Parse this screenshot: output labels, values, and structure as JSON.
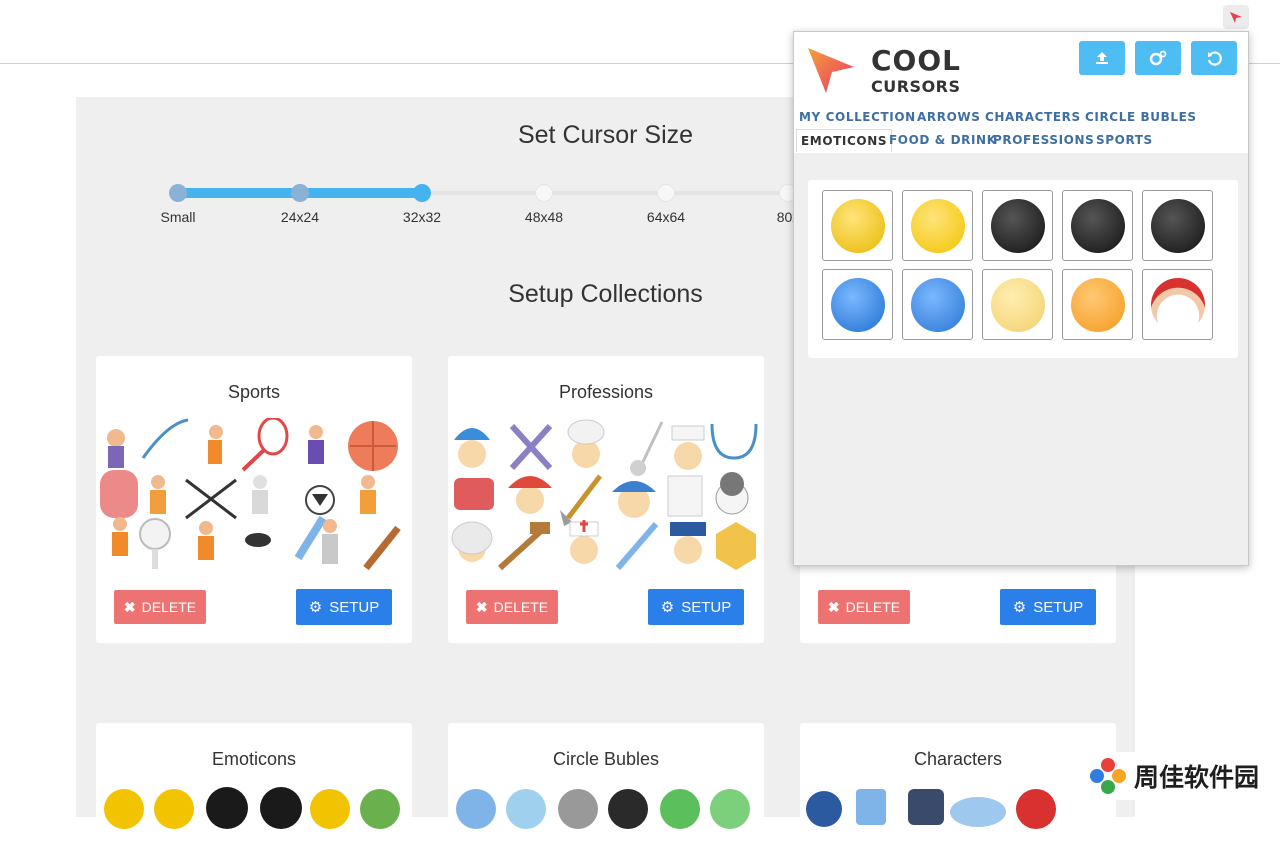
{
  "toolbar": {
    "extension_icon": "cool-cursors-arrow-icon"
  },
  "panel": {
    "size_title": "Set Cursor Size",
    "sizes": [
      "Small",
      "24x24",
      "32x32",
      "48x48",
      "64x64",
      "80x"
    ],
    "selected_size_index": 2,
    "collections_title": "Setup Collections"
  },
  "cards": [
    {
      "title": "Sports",
      "delete_label": "DELETE",
      "setup_label": "SETUP"
    },
    {
      "title": "Professions",
      "delete_label": "DELETE",
      "setup_label": "SETUP"
    },
    {
      "title": "",
      "delete_label": "DELETE",
      "setup_label": "SETUP"
    }
  ],
  "bottom_cards": [
    {
      "title": "Emoticons"
    },
    {
      "title": "Circle Bubles"
    },
    {
      "title": "Characters"
    }
  ],
  "popup": {
    "logo_line1": "COOL",
    "logo_line2": "CURSORS",
    "buttons": [
      "upload-icon",
      "settings-icon",
      "reset-icon"
    ],
    "tabs_row1": [
      "MY COLLECTION",
      "ARROWS",
      "CHARACTERS",
      "CIRCLE BUBLES"
    ],
    "tabs_row2": [
      "EMOTICONS",
      "FOOD & DRINK",
      "PROFESSIONS",
      "SPORTS"
    ],
    "active_tab": "EMOTICONS",
    "emoticons": [
      {
        "name": "yellow-grumpy",
        "color": "#e8b800"
      },
      {
        "name": "yellow-bored",
        "color": "#f2c300"
      },
      {
        "name": "black-sunglasses",
        "color": "#1a1a1a"
      },
      {
        "name": "black-eyes-up",
        "color": "#111111"
      },
      {
        "name": "black-shocked",
        "color": "#111111"
      },
      {
        "name": "blue-grumpy",
        "color": "#1f6fd0"
      },
      {
        "name": "blue-bored",
        "color": "#2a74d2"
      },
      {
        "name": "cream-smile",
        "color": "#f2cf6d"
      },
      {
        "name": "orange-speech",
        "color": "#f39a1d"
      },
      {
        "name": "santa",
        "color": "#d93030"
      }
    ]
  },
  "colors": {
    "accent": "#45b3ef",
    "delete": "#ed7373",
    "setup": "#2b7fe8",
    "header_buttons": "#4dbdf4",
    "tab_text": "#3f6fa2"
  },
  "watermark": {
    "text": "周佳软件园"
  }
}
